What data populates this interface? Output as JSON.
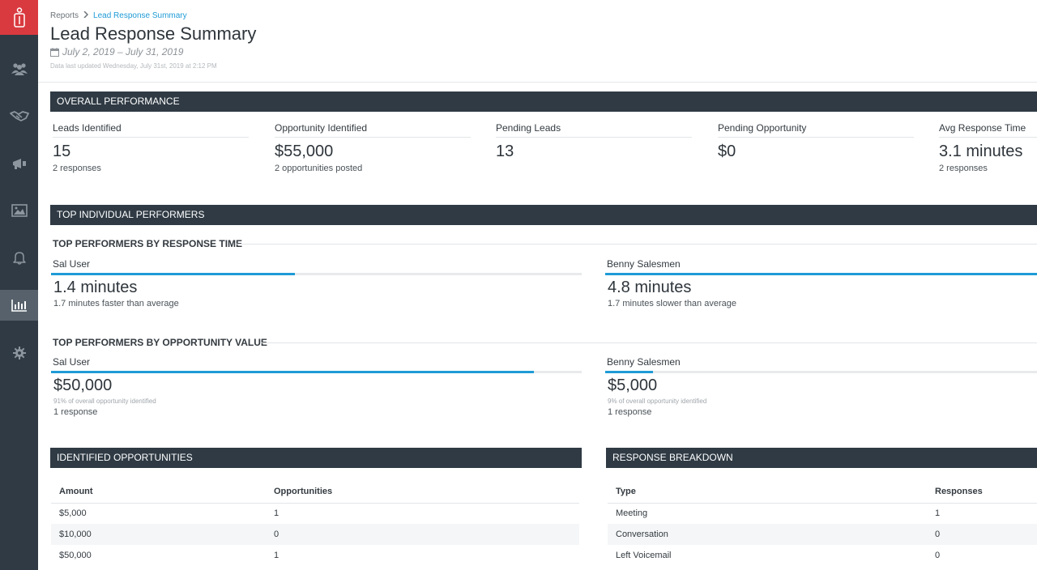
{
  "sidebar": {
    "logo_icon": "person-badge-icon",
    "items": [
      {
        "name": "people-icon",
        "active": false
      },
      {
        "name": "handshake-icon",
        "active": false
      },
      {
        "name": "megaphone-icon",
        "active": false
      },
      {
        "name": "image-icon",
        "active": false
      },
      {
        "name": "bell-icon",
        "active": false
      },
      {
        "name": "bar-chart-icon",
        "active": true
      },
      {
        "name": "gear-icon",
        "active": false
      }
    ],
    "colors": {
      "background": "#2f3a44",
      "logo": "#d93a3f",
      "active": "#56616b"
    }
  },
  "header": {
    "breadcrumb": {
      "parent": "Reports",
      "current": "Lead Response Summary"
    },
    "title": "Lead Response Summary",
    "date_range": "July 2, 2019 – July 31, 2019",
    "updated": "Data last updated Wednesday, July 31st, 2019 at 2:12 PM"
  },
  "overall": {
    "title": "OVERALL PERFORMANCE",
    "stats": [
      {
        "label": "Leads Identified",
        "value": "15",
        "sub": "2 responses"
      },
      {
        "label": "Opportunity Identified",
        "value": "$55,000",
        "sub": "2 opportunities posted"
      },
      {
        "label": "Pending Leads",
        "value": "13",
        "sub": ""
      },
      {
        "label": "Pending Opportunity",
        "value": "$0",
        "sub": ""
      },
      {
        "label": "Avg Response Time",
        "value": "3.1 minutes",
        "sub": "2 responses"
      }
    ]
  },
  "top_performers": {
    "title": "TOP INDIVIDUAL PERFORMERS",
    "by_response_time": {
      "heading": "TOP PERFORMERS BY RESPONSE TIME",
      "people": [
        {
          "name": "Sal User",
          "value": "1.4 minutes",
          "note": "1.7 minutes faster than average",
          "bar": 0.46
        },
        {
          "name": "Benny Salesmen",
          "value": "4.8 minutes",
          "note": "1.7 minutes slower than average",
          "bar": 1.0
        }
      ]
    },
    "by_opportunity_value": {
      "heading": "TOP PERFORMERS BY OPPORTUNITY VALUE",
      "people": [
        {
          "name": "Sal User",
          "value": "$50,000",
          "share": "91% of overall opportunity identified",
          "responses": "1 response",
          "bar": 0.91
        },
        {
          "name": "Benny Salesmen",
          "value": "$5,000",
          "share": "9% of overall opportunity identified",
          "responses": "1 response",
          "bar": 0.09
        }
      ]
    }
  },
  "identified_opportunities": {
    "title": "IDENTIFIED OPPORTUNITIES",
    "columns": [
      "Amount",
      "Opportunities"
    ],
    "rows": [
      [
        "$5,000",
        "1"
      ],
      [
        "$10,000",
        "0"
      ],
      [
        "$50,000",
        "1"
      ]
    ]
  },
  "response_breakdown": {
    "title": "RESPONSE BREAKDOWN",
    "columns": [
      "Type",
      "Responses"
    ],
    "rows": [
      [
        "Meeting",
        "1"
      ],
      [
        "Conversation",
        "0"
      ],
      [
        "Left Voicemail",
        "0"
      ]
    ]
  },
  "colors": {
    "accent": "#1f9bd6",
    "section_bar": "#2f3a44"
  }
}
